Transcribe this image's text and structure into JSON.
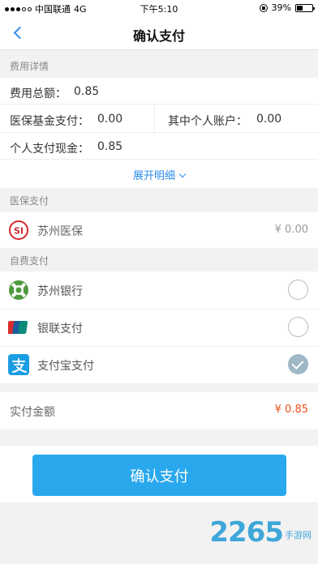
{
  "status_bar": {
    "carrier": "中国联通",
    "network": "4G",
    "time": "下午5:10",
    "battery": "39%",
    "battery_level": 0.39
  },
  "nav": {
    "title": "确认支付"
  },
  "fee_details": {
    "section_title": "费用详情",
    "total_label": "费用总额：",
    "total_value": "0.85",
    "insurance_fund_label": "医保基金支付：",
    "insurance_fund_value": "0.00",
    "personal_account_label": "其中个人账户：",
    "personal_account_value": "0.00",
    "personal_cash_label": "个人支付现金：",
    "personal_cash_value": "0.85",
    "expand_label": "展开明细"
  },
  "medical_insurance": {
    "section_title": "医保支付",
    "name": "苏州医保",
    "amount": "¥ 0.00"
  },
  "self_pay": {
    "section_title": "自费支付",
    "options": [
      {
        "label": "苏州银行",
        "checked": false
      },
      {
        "label": "银联支付",
        "checked": false
      },
      {
        "label": "支付宝支付",
        "checked": true
      }
    ]
  },
  "actual": {
    "label": "实付金额",
    "amount": "¥ 0.85"
  },
  "confirm_button": "确认支付",
  "watermark": {
    "number": "2265",
    "text": "手游网"
  },
  "colors": {
    "accent": "#2d8ce9",
    "button": "#29a8ee",
    "amount_red": "#e8501a"
  }
}
